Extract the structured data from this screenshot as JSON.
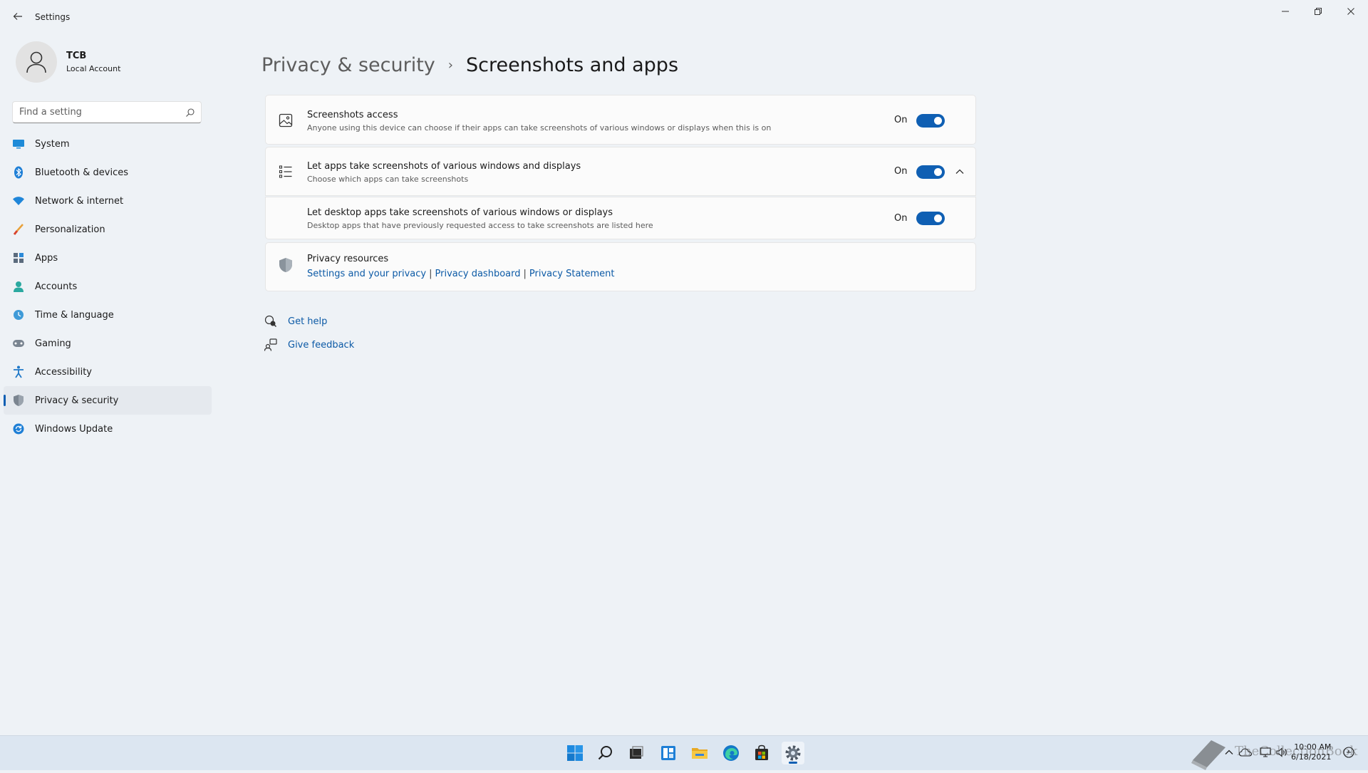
{
  "window": {
    "app_title": "Settings"
  },
  "profile": {
    "name": "TCB",
    "account_type": "Local Account"
  },
  "search": {
    "placeholder": "Find a setting"
  },
  "sidebar": {
    "items": [
      {
        "label": "System",
        "icon": "monitor-icon"
      },
      {
        "label": "Bluetooth & devices",
        "icon": "bluetooth-icon"
      },
      {
        "label": "Network & internet",
        "icon": "wifi-icon"
      },
      {
        "label": "Personalization",
        "icon": "brush-icon"
      },
      {
        "label": "Apps",
        "icon": "apps-icon"
      },
      {
        "label": "Accounts",
        "icon": "person-icon"
      },
      {
        "label": "Time & language",
        "icon": "globe-clock-icon"
      },
      {
        "label": "Gaming",
        "icon": "gamepad-icon"
      },
      {
        "label": "Accessibility",
        "icon": "accessibility-icon"
      },
      {
        "label": "Privacy & security",
        "icon": "shield-icon",
        "selected": true
      },
      {
        "label": "Windows Update",
        "icon": "update-icon"
      }
    ]
  },
  "breadcrumb": {
    "parent": "Privacy & security",
    "separator": "›",
    "current": "Screenshots and apps"
  },
  "settings": {
    "screenshots_access": {
      "title": "Screenshots access",
      "description": "Anyone using this device can choose if their apps can take screenshots of various windows or displays when this is on",
      "state": "On",
      "enabled": true
    },
    "let_apps": {
      "title": "Let apps take screenshots of various windows and displays",
      "description": "Choose which apps can take screenshots",
      "state": "On",
      "enabled": true,
      "expanded": true
    },
    "desktop_apps": {
      "title": "Let desktop apps take screenshots of various windows or displays",
      "description": "Desktop apps that have previously requested access to take screenshots are listed here",
      "state": "On",
      "enabled": true
    }
  },
  "privacy_resources": {
    "title": "Privacy resources",
    "links": [
      "Settings and your privacy",
      "Privacy dashboard",
      "Privacy Statement"
    ],
    "separator": "|"
  },
  "help": {
    "get_help": "Get help",
    "give_feedback": "Give feedback"
  },
  "taskbar": {
    "apps": [
      "windows-start-icon",
      "search-icon",
      "task-view-icon",
      "widgets-icon",
      "file-explorer-icon",
      "edge-browser-icon",
      "store-icon",
      "settings-gear-icon"
    ],
    "watermark": "TheCollectionBook",
    "time": "10:00 AM",
    "date": "6/18/2021"
  },
  "colors": {
    "accent": "#0f5fb3",
    "link": "#0c5aa6",
    "background": "#eef2f6",
    "card": "#fbfbfb"
  }
}
